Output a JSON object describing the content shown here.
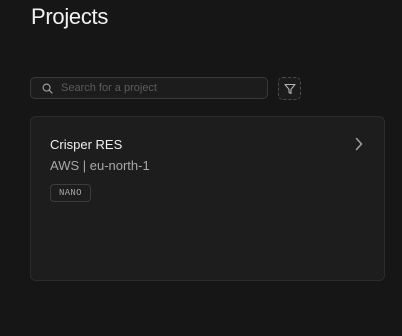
{
  "page": {
    "title": "Projects"
  },
  "search": {
    "placeholder": "Search for a project",
    "value": ""
  },
  "filter": {
    "icon": "filter-icon"
  },
  "projects": [
    {
      "name": "Crisper RES",
      "region": "AWS | eu-north-1",
      "badge": "NANO"
    }
  ],
  "colors": {
    "background": "#161616",
    "card": "#1d1d1d",
    "border": "#2c2c2c",
    "text_primary": "#f0f0f0",
    "text_secondary": "#a8a8a8"
  }
}
